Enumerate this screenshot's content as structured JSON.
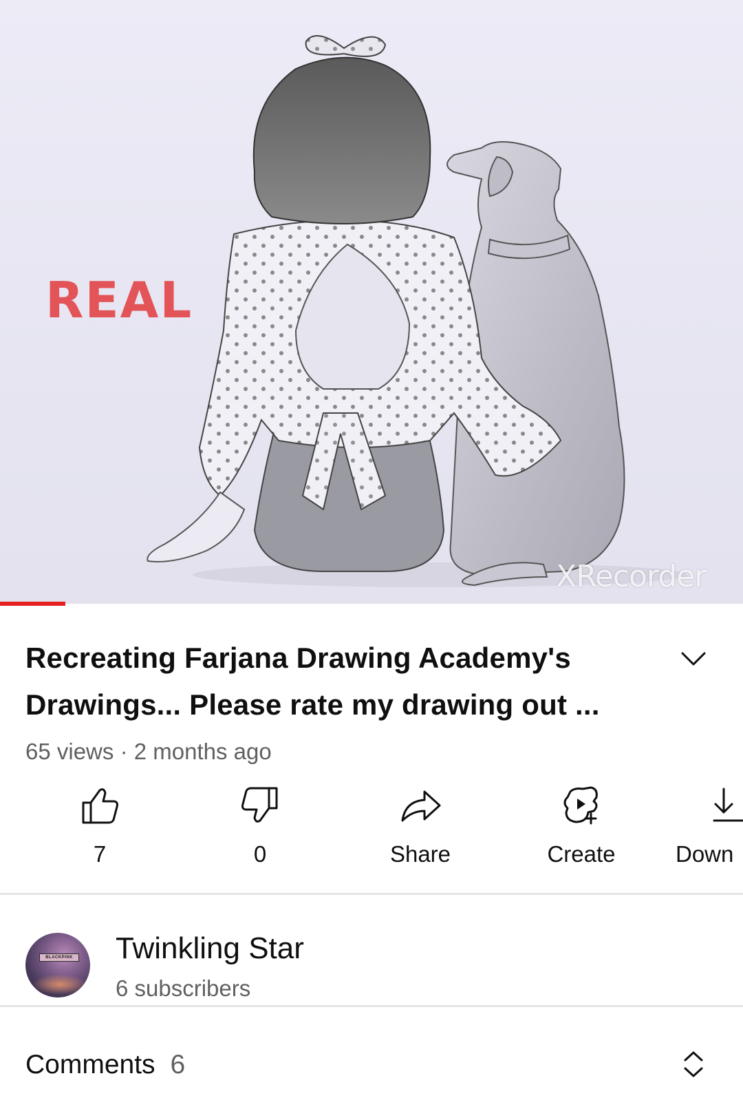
{
  "video": {
    "overlay_text": "REAL",
    "watermark": "XRecorder",
    "progress_fraction": 0.088
  },
  "title": {
    "line1": "Recreating Farjana Drawing Academy's",
    "line2": "Drawings... Please rate my drawing out ..."
  },
  "meta": {
    "views": "65 views",
    "separator": "·",
    "age": "2 months ago"
  },
  "actions": {
    "like_count": "7",
    "dislike_count": "0",
    "share_label": "Share",
    "create_label": "Create",
    "download_label": "Down"
  },
  "channel": {
    "name": "Twinkling Star",
    "subscribers": "6 subscribers",
    "avatar_text": "BLACKPINK"
  },
  "comments": {
    "label": "Comments",
    "count": "6"
  },
  "colors": {
    "progress_red": "#e4201e",
    "overlay_red": "#e25457",
    "secondary_text": "#606060"
  }
}
